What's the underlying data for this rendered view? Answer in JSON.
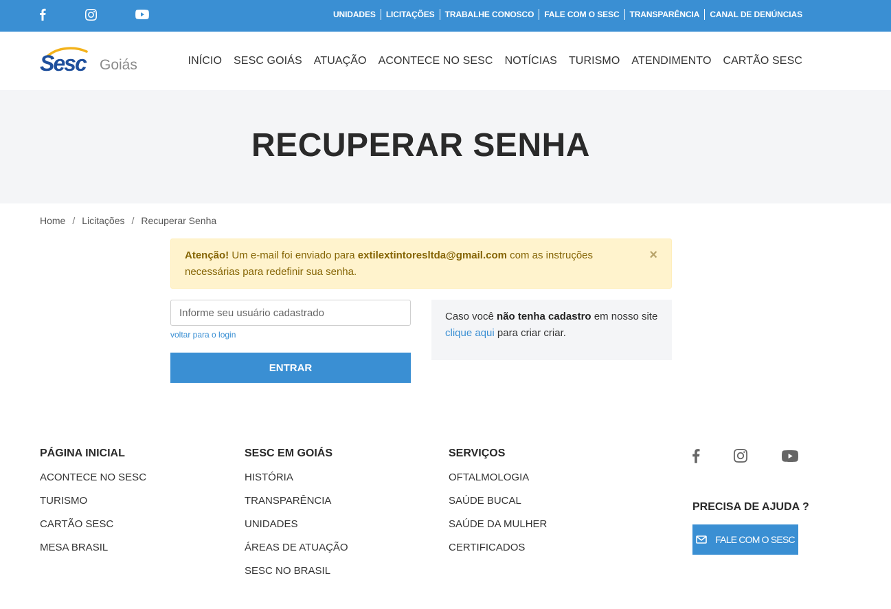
{
  "topbar": {
    "social": [
      "facebook-icon",
      "instagram-icon",
      "youtube-icon"
    ],
    "links": [
      "UNIDADES",
      "LICITAÇÕES",
      "TRABALHE CONOSCO",
      "FALE COM O SESC",
      "TRANSPARÊNCIA",
      "CANAL DE DENÚNCIAS"
    ]
  },
  "header": {
    "logo_text": "Sesc",
    "logo_region": "Goiás",
    "nav": [
      "INÍCIO",
      "SESC GOIÁS",
      "ATUAÇÃO",
      "ACONTECE NO SESC",
      "NOTÍCIAS",
      "TURISMO",
      "ATENDIMENTO",
      "CARTÃO SESC"
    ]
  },
  "banner": {
    "title": "RECUPERAR SENHA"
  },
  "breadcrumb": {
    "items": [
      "Home",
      "Licitações",
      "Recuperar Senha"
    ],
    "separator": "/"
  },
  "alert": {
    "strong": "Atenção!",
    "text_before": " Um e-mail foi enviado para ",
    "email": "extilextintoresltda@gmail.com",
    "text_after": " com as instruções necessárias para redefinir sua senha.",
    "close": "×"
  },
  "form": {
    "username_placeholder": "Informe seu usuário cadastrado",
    "username_value": "",
    "back_link": "voltar para o login",
    "submit_label": "ENTRAR"
  },
  "info": {
    "text_before": "Caso você ",
    "strong": "não tenha cadastro",
    "text_middle": " em nosso site ",
    "link": "clique aqui",
    "text_after": " para criar criar."
  },
  "footer": {
    "columns": [
      {
        "title": "PÁGINA INICIAL",
        "links": [
          "ACONTECE NO SESC",
          "TURISMO",
          "CARTÃO SESC",
          "MESA BRASIL"
        ]
      },
      {
        "title": "SESC EM GOIÁS",
        "links": [
          "HISTÓRIA",
          "TRANSPARÊNCIA",
          "UNIDADES",
          "ÁREAS DE ATUAÇÃO",
          "SESC NO BRASIL"
        ]
      },
      {
        "title": "SERVIÇOS",
        "links": [
          "OFTALMOLOGIA",
          "SAÚDE BUCAL",
          "SAÚDE DA MULHER",
          "CERTIFICADOS"
        ]
      }
    ],
    "social": [
      "facebook-icon",
      "instagram-icon",
      "youtube-icon"
    ],
    "help_title": "PRECISA DE AJUDA ?",
    "contact_button": "FALE COM O SESC"
  },
  "colors": {
    "primary": "#3a8fd3",
    "alert_bg": "#fff3cd",
    "alert_text": "#856404",
    "banner_bg": "#f4f5f7"
  }
}
